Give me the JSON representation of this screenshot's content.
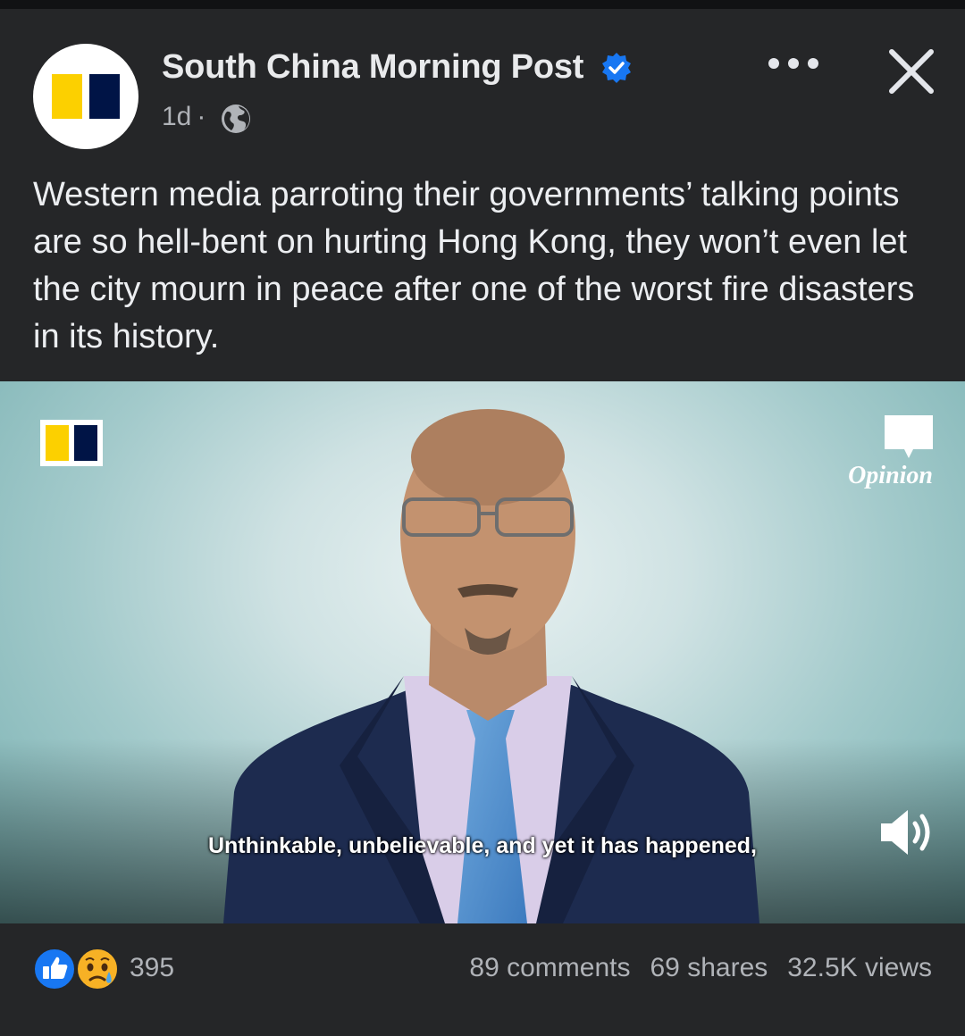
{
  "post": {
    "page_name": "South China Morning Post",
    "verified_icon": "verified-badge-icon",
    "time": "1d",
    "separator": "·",
    "privacy_icon": "globe-icon",
    "text": "Western media parroting their governments’ talking points are so hell-bent on hurting Hong Kong, they won’t even let the city mourn in peace after one of the worst fire disasters in its history."
  },
  "video": {
    "badge_label": "Opinion",
    "subtitle": "Unthinkable, unbelievable, and yet it has happened,",
    "sound_icon": "speaker-icon"
  },
  "footer": {
    "reaction_count": "395",
    "comments": "89 comments",
    "shares": "69 shares",
    "views": "32.5K views"
  },
  "colors": {
    "background": "#252628",
    "brand_yellow": "#fcd000",
    "brand_navy": "#001446",
    "verified_blue": "#1877f2"
  }
}
